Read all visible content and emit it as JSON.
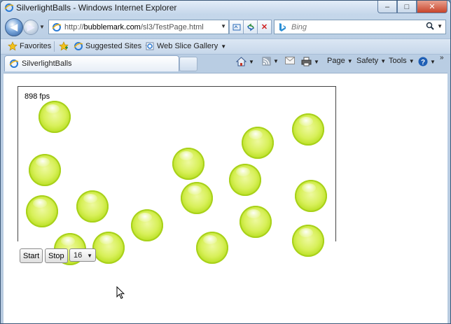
{
  "window": {
    "title": "SilverlightBalls - Windows Internet Explorer",
    "controls": {
      "minimize": "–",
      "maximize": "□",
      "close": "✕"
    }
  },
  "nav": {
    "url_prefix": "http://",
    "url_host": "bubblemark.com",
    "url_path": "/sl3/TestPage.html",
    "search_placeholder": "Bing"
  },
  "favorites_bar": {
    "favorites_label": "Favorites",
    "items": [
      "Suggested Sites",
      "Web Slice Gallery"
    ]
  },
  "tabs": {
    "active_tab_label": "SilverlightBalls"
  },
  "command_bar": {
    "page_label": "Page",
    "safety_label": "Safety",
    "tools_label": "Tools"
  },
  "app": {
    "fps_text": "898 fps",
    "start_label": "Start",
    "stop_label": "Stop",
    "ball_count_value": "16"
  },
  "colors": {
    "ball": "#c8e832",
    "chrome": "#c4d6ea"
  },
  "icons": [
    "ie-icon",
    "back-arrow-icon",
    "forward-arrow-icon",
    "page-icon",
    "compatibility-icon",
    "refresh-icon",
    "stop-icon",
    "bing-icon",
    "search-icon",
    "star-icon",
    "add-favorites-icon",
    "suggested-sites-icon",
    "web-slice-icon",
    "home-icon",
    "rss-icon",
    "mail-icon",
    "print-icon",
    "help-icon",
    "mouse-cursor-icon"
  ]
}
